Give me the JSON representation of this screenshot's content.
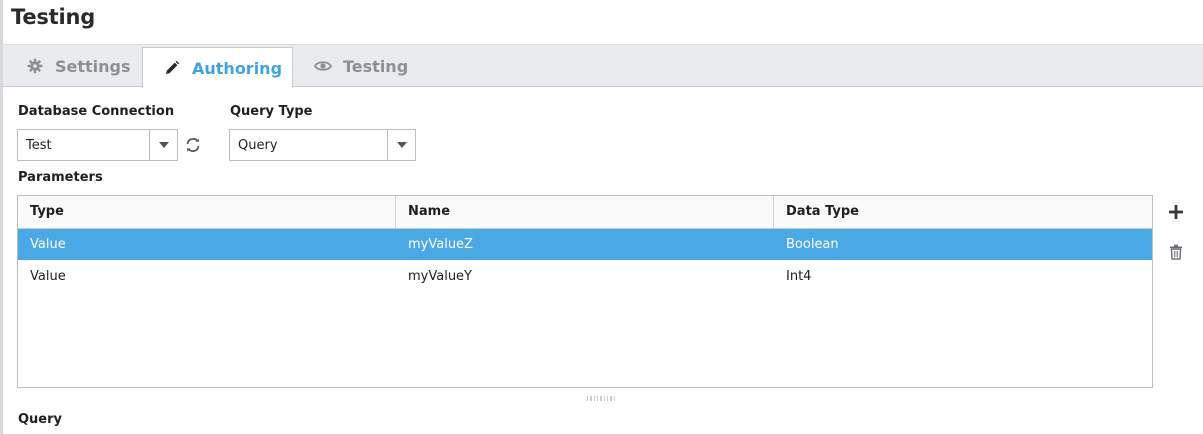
{
  "page": {
    "title": "Testing"
  },
  "tabs": [
    {
      "label": "Settings",
      "icon": "gear-icon",
      "active": false
    },
    {
      "label": "Authoring",
      "icon": "pencil-icon",
      "active": true
    },
    {
      "label": "Testing",
      "icon": "eye-icon",
      "active": false
    }
  ],
  "database_connection": {
    "label": "Database Connection",
    "value": "Test"
  },
  "query_type": {
    "label": "Query Type",
    "value": "Query"
  },
  "parameters": {
    "label": "Parameters",
    "columns": [
      "Type",
      "Name",
      "Data Type"
    ],
    "rows": [
      {
        "type": "Value",
        "name": "myValueZ",
        "data_type": "Boolean",
        "selected": true
      },
      {
        "type": "Value",
        "name": "myValueY",
        "data_type": "Int4",
        "selected": false
      }
    ]
  },
  "query": {
    "label": "Query"
  },
  "colors": {
    "accent": "#3fa3e0",
    "selection": "#4aa8e5",
    "tabbar_bg": "#e9ebee",
    "muted_tab": "#8c9094"
  }
}
